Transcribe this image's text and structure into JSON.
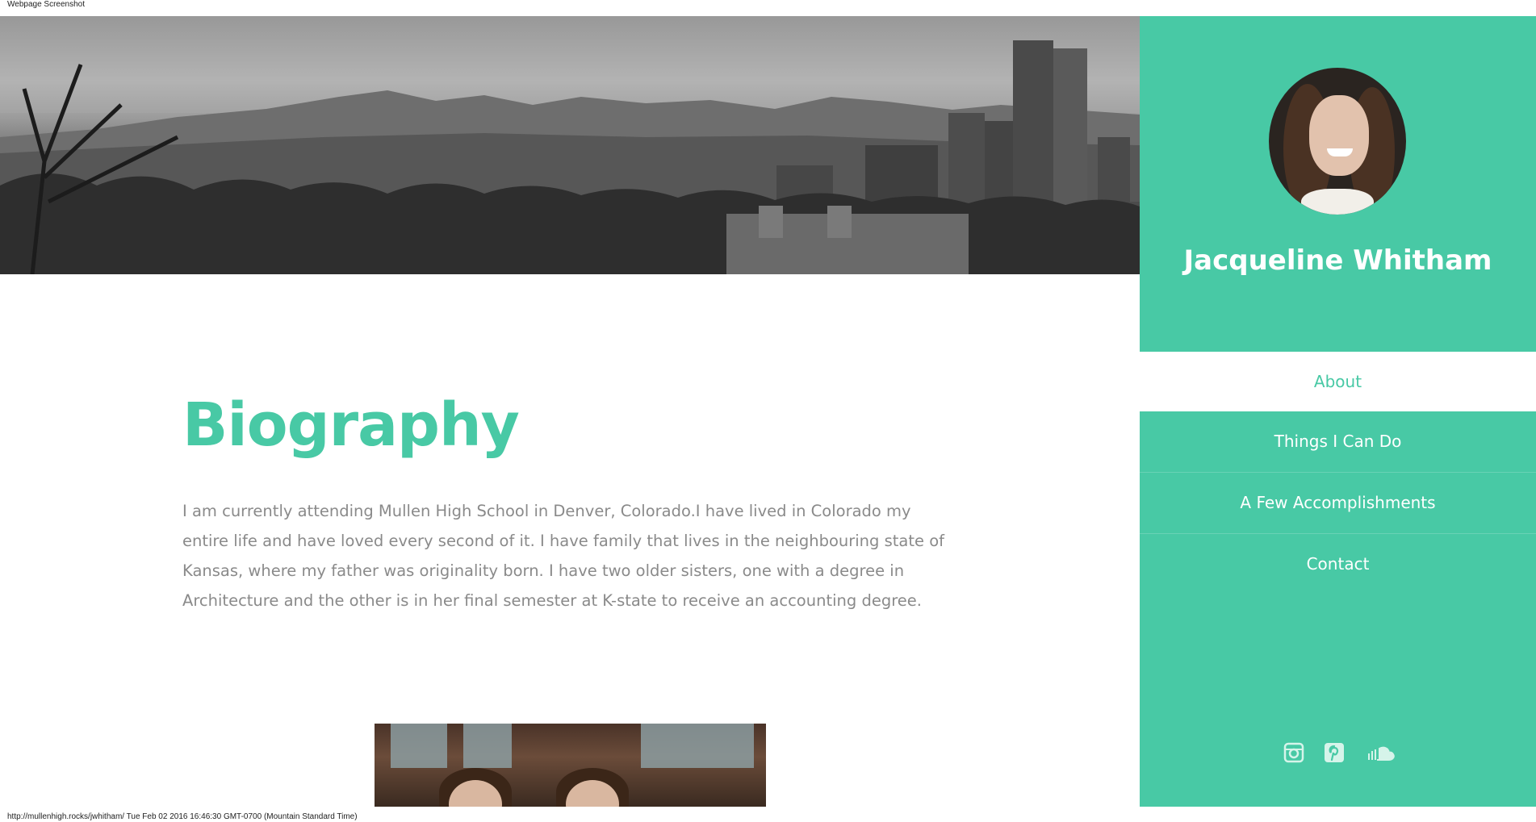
{
  "window": {
    "top_caption": "Webpage Screenshot",
    "bottom_caption": "http://mullenhigh.rocks/jwhitham/ Tue Feb 02 2016 16:46:30 GMT-0700 (Mountain Standard Time)"
  },
  "sidebar": {
    "name": "Jacqueline Whitham",
    "nav": [
      {
        "label": "About",
        "active": true
      },
      {
        "label": "Things I Can Do"
      },
      {
        "label": "A Few Accomplishments"
      },
      {
        "label": "Contact"
      }
    ],
    "social_icons": [
      "instagram-icon",
      "pinterest-icon",
      "soundcloud-icon"
    ]
  },
  "main": {
    "title": "Biography",
    "text": "I am currently attending Mullen High School in Denver, Colorado.I have lived in Colorado my entire life and have loved every second of it. I have family that lives in the neighbouring state of Kansas, where my father was originality born. I have two older sisters, one with a degree in Architecture and the other is in her final semester at K-state to receive an accounting degree."
  },
  "colors": {
    "accent": "#48c9a5",
    "text_gray": "#8a8a8a",
    "white": "#ffffff"
  }
}
